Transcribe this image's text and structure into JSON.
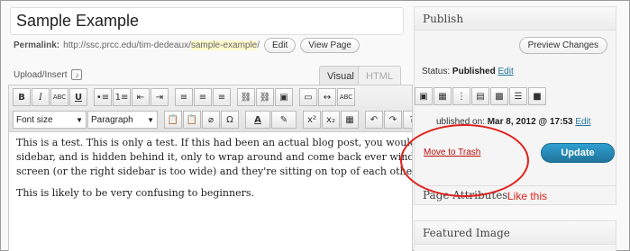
{
  "post": {
    "title": "Sample Example",
    "permalink_label": "Permalink:",
    "permalink_base": "http://ssc.prcc.edu/tim-dedeaux/",
    "permalink_slug": "sample-example",
    "permalink_trail": "/",
    "edit_label": "Edit",
    "view_label": "View Page"
  },
  "upload_insert": "Upload/Insert",
  "editor_tabs": {
    "visual": "Visual",
    "html": "HTML"
  },
  "toolbar": {
    "row1": [
      "B",
      "I",
      "ABC",
      "U",
      "•≡",
      "1≡",
      "⇤",
      "⇥",
      "≡",
      "≡",
      "≡",
      "⛓",
      "⛓",
      "▣",
      "▭",
      "↔",
      "ABC"
    ],
    "font_size_label": "Font size",
    "format_label": "Paragraph",
    "row2": [
      "📋",
      "📋",
      "⌀",
      "Ω",
      "A",
      "✎",
      "x²",
      "x₂",
      "▦",
      "↶",
      "↷",
      "?"
    ]
  },
  "content": {
    "paragraph1": "This is a test.  This is only a test.  If this had been an actual blog post, you would not be over into the sidebar, and is hidden behind it, only to wrap around and come back ever window is too wide for the screen (or the right sidebar is too wide) and they're sitting on top of each other.",
    "paragraph2": "This is likely to be very confusing to beginners."
  },
  "publish": {
    "title": "Publish",
    "preview_label": "Preview Changes",
    "status_label": "Status:",
    "status_value": "Published",
    "status_edit": "Edit",
    "published_text": "ublished on:",
    "published_date": "Mar 8, 2012 @ 17:53",
    "published_edit": "Edit",
    "trash_label": "Move to Trash",
    "update_label": "Update"
  },
  "page_attributes": {
    "title": "Page Attributes"
  },
  "featured_image": {
    "title": "Featured Image"
  },
  "annotation": {
    "text": "Like this",
    "color": "#e0201b"
  },
  "colors": {
    "accent": "#21759b",
    "trash": "#bc0b0b"
  }
}
